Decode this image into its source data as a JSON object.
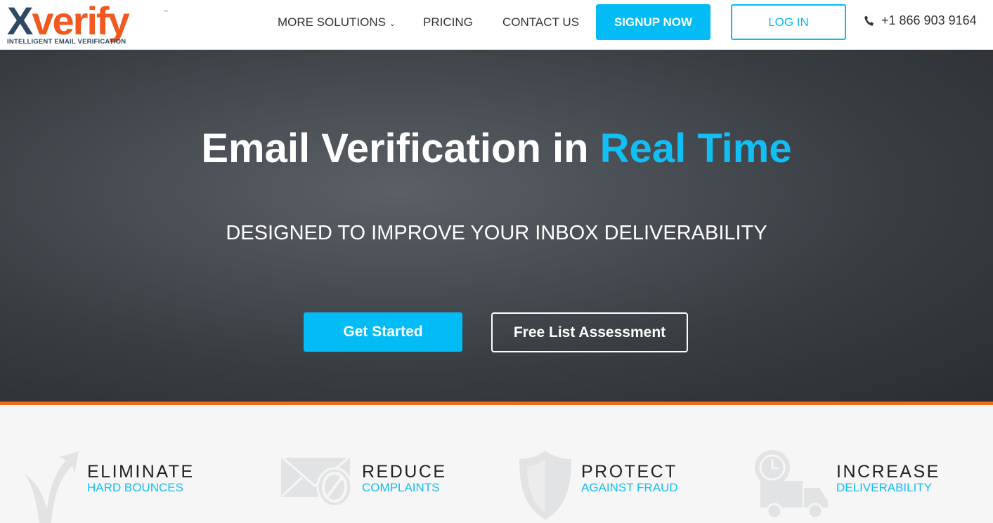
{
  "logo": {
    "word_a": "X",
    "word_b": "verify",
    "tagline": "INTELLIGENT EMAIL VERIFICATION",
    "tm": "™"
  },
  "nav": {
    "more_solutions": "MORE SOLUTIONS",
    "pricing": "PRICING",
    "contact": "CONTACT US",
    "signup": "SIGNUP NOW",
    "login": "LOG IN",
    "phone": "+1 866 903 9164"
  },
  "hero": {
    "title_a": "Email Verification in ",
    "title_b": "Real Time",
    "subtitle": "DESIGNED TO IMPROVE YOUR INBOX DELIVERABILITY",
    "get_started": "Get Started",
    "assessment": "Free List Assessment"
  },
  "features": [
    {
      "title": "ELIMINATE",
      "sub": "HARD BOUNCES",
      "icon": "checkmark-arrow-icon"
    },
    {
      "title": "REDUCE",
      "sub": "COMPLAINTS",
      "icon": "envelope-blocked-icon"
    },
    {
      "title": "PROTECT",
      "sub": "AGAINST FRAUD",
      "icon": "shield-icon"
    },
    {
      "title": "INCREASE",
      "sub": "DELIVERABILITY",
      "icon": "delivery-truck-clock-icon"
    }
  ],
  "colors": {
    "accent": "#03bcf5",
    "orange": "#f26b1d",
    "navy": "#2e4a63"
  }
}
